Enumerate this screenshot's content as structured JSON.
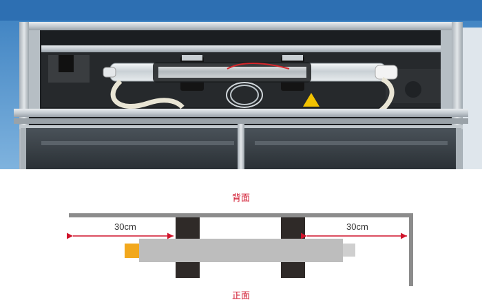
{
  "photo": {
    "subject": "laser-tube-installed-in-machine"
  },
  "diagram": {
    "back_label": "背面",
    "front_label": "正面",
    "left_distance": "30cm",
    "right_distance": "30cm",
    "colors": {
      "label": "#d0142b",
      "arrow": "#d0142b",
      "frame": "#8c8c8c",
      "tube": "#bdbdbd",
      "tube_end": "#cfcfcf",
      "bracket": "#2f2a28",
      "connector": "#f2a81d",
      "dimension_text": "#333333"
    }
  }
}
